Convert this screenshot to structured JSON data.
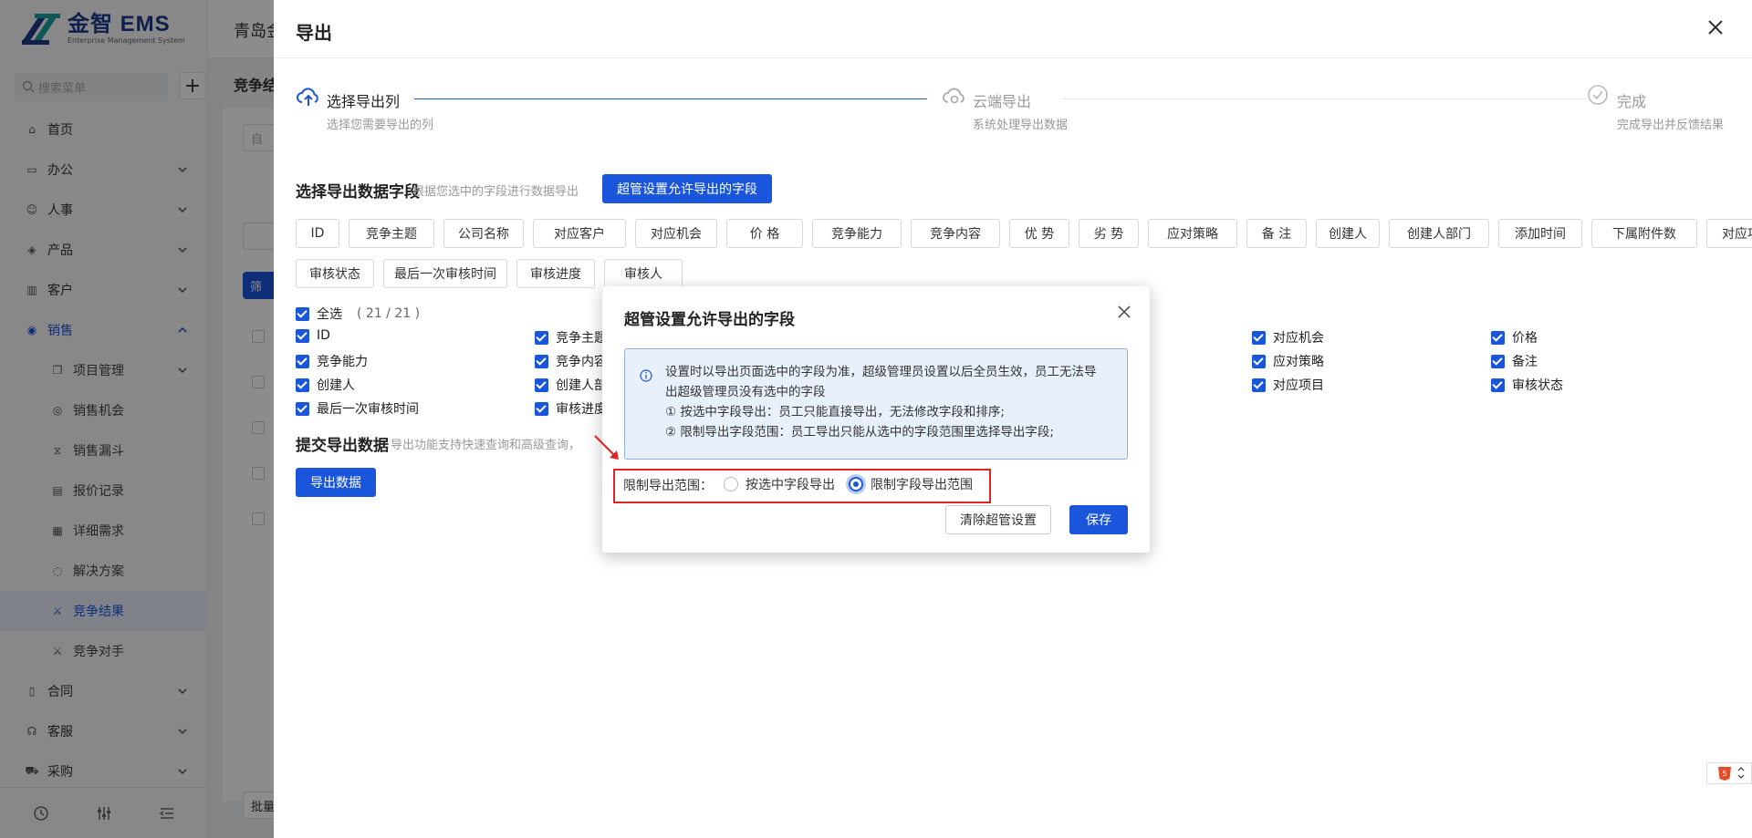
{
  "app": {
    "logo_text": "金智 EMS",
    "logo_sub": "Enterprise Management System",
    "company": "青岛金"
  },
  "sidebar": {
    "search_placeholder": "搜索菜单",
    "items": [
      {
        "label": "首页",
        "icon": "home-icon"
      },
      {
        "label": "办公",
        "icon": "office-icon",
        "expand": true
      },
      {
        "label": "人事",
        "icon": "people-icon",
        "expand": true
      },
      {
        "label": "产品",
        "icon": "box-icon",
        "expand": true
      },
      {
        "label": "客户",
        "icon": "chart-icon",
        "expand": true
      },
      {
        "label": "销售",
        "icon": "sales-icon",
        "expand": true,
        "open": true
      },
      {
        "label": "项目管理",
        "icon": "project-icon",
        "sub": true,
        "expand": true
      },
      {
        "label": "销售机会",
        "icon": "opportunity-icon",
        "sub": true
      },
      {
        "label": "销售漏斗",
        "icon": "funnel-icon",
        "sub": true
      },
      {
        "label": "报价记录",
        "icon": "quote-icon",
        "sub": true
      },
      {
        "label": "详细需求",
        "icon": "requirement-icon",
        "sub": true
      },
      {
        "label": "解决方案",
        "icon": "bulb-icon",
        "sub": true
      },
      {
        "label": "竞争结果",
        "icon": "competition-icon",
        "sub": true,
        "active": true
      },
      {
        "label": "竞争对手",
        "icon": "competitor-icon",
        "sub": true
      },
      {
        "label": "合同",
        "icon": "contract-icon",
        "expand": true
      },
      {
        "label": "客服",
        "icon": "service-icon",
        "expand": true
      },
      {
        "label": "采购",
        "icon": "purchase-icon",
        "expand": true
      }
    ]
  },
  "background": {
    "subhead": "竞争结",
    "input_placeholder": "自",
    "filter_btn": "筛",
    "batch_btn": "批量"
  },
  "drawer": {
    "title": "导出",
    "steps": [
      {
        "title": "选择导出列",
        "desc": "选择您需要导出的列",
        "icon": "cloud-upload-icon",
        "active": true
      },
      {
        "title": "云端导出",
        "desc": "系统处理导出数据",
        "icon": "cloud-sync-icon"
      },
      {
        "title": "完成",
        "desc": "完成导出并反馈结果",
        "icon": "check-circle-icon"
      }
    ],
    "select_section": {
      "title": "选择导出数据字段",
      "desc": "根据您选中的字段进行数据导出",
      "button": "超管设置允许导出的字段"
    },
    "fields": [
      "ID",
      "竞争主题",
      "公司名称",
      "对应客户",
      "对应机会",
      "价 格",
      "竞争能力",
      "竞争内容",
      "优 势",
      "劣 势",
      "应对策略",
      "备 注",
      "创建人",
      "创建人部门",
      "添加时间",
      "下属附件数",
      "对应项目",
      "审核状态",
      "最后一次审核时间",
      "审核进度",
      "审核人"
    ],
    "select_all": {
      "label": "全选",
      "count": "( 21 / 21 )"
    },
    "checked": {
      "col1": [
        "ID",
        "竞争能力",
        "创建人",
        "最后一次审核时间"
      ],
      "col2": [
        "竞争主题",
        "竞争内容",
        "创建人部",
        "审核进度"
      ],
      "col5": [
        "对应机会",
        "应对策略",
        "对应项目"
      ],
      "col6": [
        "价格",
        "备注",
        "审核状态"
      ]
    },
    "submit_section": {
      "title": "提交导出数据",
      "desc": "导出功能支持快速查询和高级查询，",
      "button": "导出数据"
    }
  },
  "modal": {
    "title": "超管设置允许导出的字段",
    "info_lines": [
      "设置时以导出页面选中的字段为准，超级管理员设置以后全员生效，员工无法导",
      "出超级管理员没有选中的字段",
      "① 按选中字段导出：员工只能直接导出，无法修改字段和排序;",
      "② 限制导出字段范围：员工导出只能从选中的字段范围里选择导出字段;"
    ],
    "range_label": "限制导出范围：",
    "options": [
      {
        "label": "按选中字段导出",
        "selected": false
      },
      {
        "label": "限制字段导出范围",
        "selected": true
      }
    ],
    "clear_button": "清除超管设置",
    "save_button": "保存"
  },
  "colors": {
    "primary": "#1a56db",
    "highlight": "#e02424",
    "info_bg": "#e8f0fc"
  }
}
